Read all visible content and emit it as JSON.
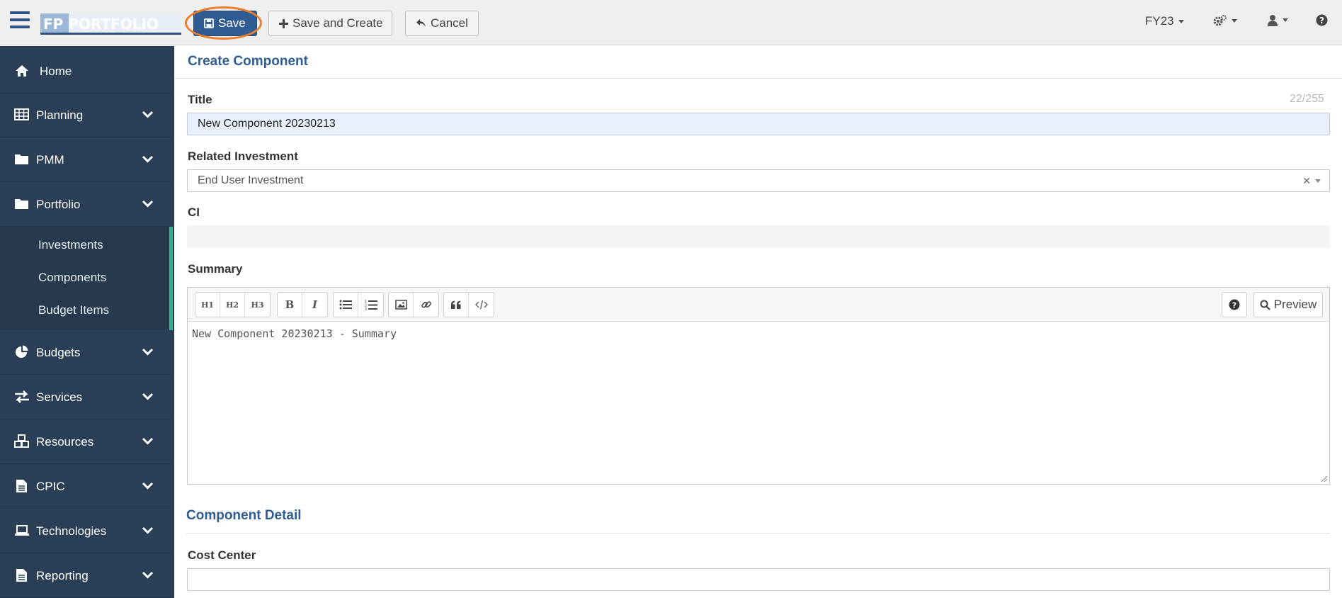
{
  "header": {
    "logo_text": "FP PORTFOLIO",
    "save_label": "Save",
    "save_create_label": "Save and Create",
    "cancel_label": "Cancel",
    "fiscal_year": "FY23"
  },
  "sidebar": {
    "items": [
      {
        "label": "Home",
        "icon": "home-icon"
      },
      {
        "label": "Planning",
        "icon": "table-icon"
      },
      {
        "label": "PMM",
        "icon": "folder-icon"
      },
      {
        "label": "Portfolio",
        "icon": "folder-icon"
      },
      {
        "label": "Budgets",
        "icon": "pie-chart-icon"
      },
      {
        "label": "Services",
        "icon": "exchange-icon"
      },
      {
        "label": "Resources",
        "icon": "cubes-icon"
      },
      {
        "label": "CPIC",
        "icon": "document-icon"
      },
      {
        "label": "Technologies",
        "icon": "laptop-icon"
      },
      {
        "label": "Reporting",
        "icon": "document-icon"
      }
    ],
    "portfolio_subitems": [
      "Investments",
      "Components",
      "Budget Items"
    ]
  },
  "form": {
    "heading": "Create Component",
    "title_label": "Title",
    "title_counter": "22/255",
    "title_value": "New Component 20230213",
    "related_investment_label": "Related Investment",
    "related_investment_value": "End User Investment",
    "ci_label": "CI",
    "ci_value": "",
    "summary_label": "Summary",
    "summary_value": "New Component 20230213 - Summary",
    "preview_label": "Preview",
    "toolbar": {
      "h1": "H1",
      "h2": "H2",
      "h3": "H3",
      "bold": "B",
      "italic": "I"
    },
    "detail_heading": "Component Detail",
    "cost_center_label": "Cost Center",
    "cost_center_value": ""
  },
  "colors": {
    "sidebar_bg": "#2a3f55",
    "accent_green": "#2fb38d",
    "primary_blue": "#2f5d93",
    "highlight_orange": "#ec7d2b"
  }
}
